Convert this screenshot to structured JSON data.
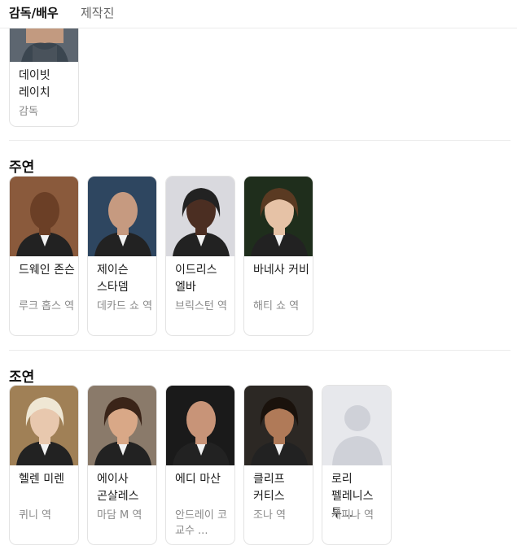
{
  "tabs": [
    {
      "label": "감독/배우",
      "active": true
    },
    {
      "label": "제작진",
      "active": false
    }
  ],
  "director": {
    "name": "데이빗 레이치",
    "role": "감독"
  },
  "sections": [
    {
      "title": "주연",
      "people": [
        {
          "name": "드웨인 존슨",
          "role": "루크 홉스 역",
          "bg": "#8a5a3c",
          "skin": "#6b3f26",
          "hair": "none"
        },
        {
          "name": "제이슨 스타뎀",
          "role": "데카드 쇼 역",
          "bg": "#2e4660",
          "skin": "#c69a80",
          "hair": "none"
        },
        {
          "name": "이드리스 엘바",
          "role": "브릭스턴 역",
          "bg": "#d9d9de",
          "skin": "#4b2e22",
          "hair": "#222"
        },
        {
          "name": "바네사 커비",
          "role": "해티 쇼 역",
          "bg": "#1f2e1c",
          "skin": "#e6c2a6",
          "hair": "#5a3a22"
        }
      ]
    },
    {
      "title": "조연",
      "people": [
        {
          "name": "헬렌 미렌",
          "role": "퀴니 역",
          "bg": "#a08056",
          "skin": "#e8c8ae",
          "hair": "#efe7d4"
        },
        {
          "name": "에이사 곤살레스",
          "role": "마담 M 역",
          "bg": "#8a7a6a",
          "skin": "#d9a887",
          "hair": "#3a2418"
        },
        {
          "name": "에디 마산",
          "role": "안드레이 코 교수 ...",
          "bg": "#1a1a1a",
          "skin": "#c89478",
          "hair": "none"
        },
        {
          "name": "클리프 커티스",
          "role": "조나 역",
          "bg": "#2c2824",
          "skin": "#b07a58",
          "hair": "#1a120c"
        },
        {
          "name": "로리 펠레니스 투...",
          "role": "세피나 역",
          "bg": "#e7e8ec",
          "skin": "#cfd1d8",
          "hair": "placeholder"
        }
      ]
    }
  ]
}
